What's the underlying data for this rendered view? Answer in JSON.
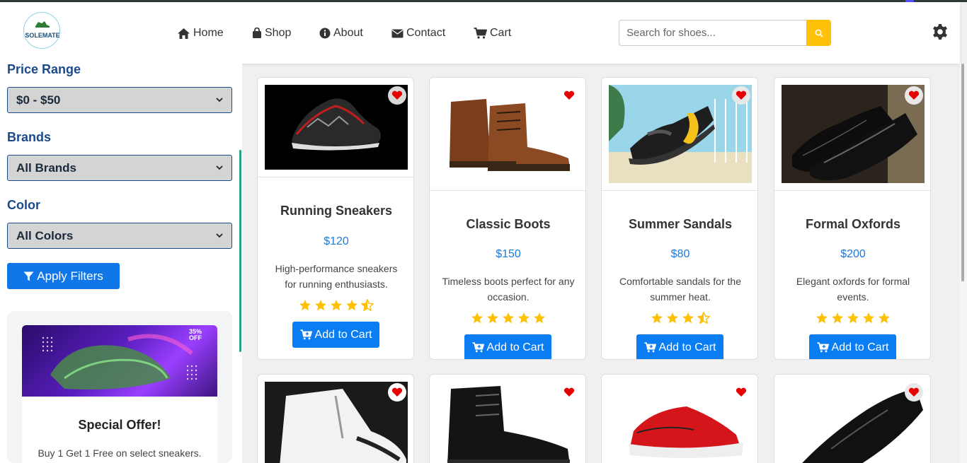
{
  "header": {
    "logo_text": "SOLEMATE",
    "nav": [
      {
        "label": "Home",
        "icon": "home-icon"
      },
      {
        "label": "Shop",
        "icon": "shopping-bag-icon"
      },
      {
        "label": "About",
        "icon": "info-circle-icon"
      },
      {
        "label": "Contact",
        "icon": "envelope-icon"
      },
      {
        "label": "Cart",
        "icon": "cart-icon"
      }
    ],
    "search_placeholder": "Search for shoes..."
  },
  "sidebar": {
    "price_label": "Price Range",
    "price_value": "$0 - $50",
    "brands_label": "Brands",
    "brands_value": "All Brands",
    "color_label": "Color",
    "color_value": "All Colors",
    "apply_label": "Apply Filters",
    "promo": {
      "badge_value": "35%",
      "badge_suffix": "OFF",
      "title": "Special Offer!",
      "text": "Buy 1 Get 1 Free on select sneakers."
    }
  },
  "products": [
    {
      "name": "Running Sneakers",
      "price": "$120",
      "desc": "High-performance sneakers for running enthusiasts.",
      "rating": 4.5,
      "button": "Add to Cart"
    },
    {
      "name": "Classic Boots",
      "price": "$150",
      "desc": "Timeless boots perfect for any occasion.",
      "rating": 5,
      "button": "Add to Cart"
    },
    {
      "name": "Summer Sandals",
      "price": "$80",
      "desc": "Comfortable sandals for the summer heat.",
      "rating": 3.5,
      "button": "Add to Cart"
    },
    {
      "name": "Formal Oxfords",
      "price": "$200",
      "desc": "Elegant oxfords for formal events.",
      "rating": 5,
      "button": "Add to Cart"
    }
  ],
  "colors": {
    "accent": "#1177e8",
    "star": "#ffc107",
    "heart": "#e60000",
    "heading": "#1a4a8a"
  }
}
